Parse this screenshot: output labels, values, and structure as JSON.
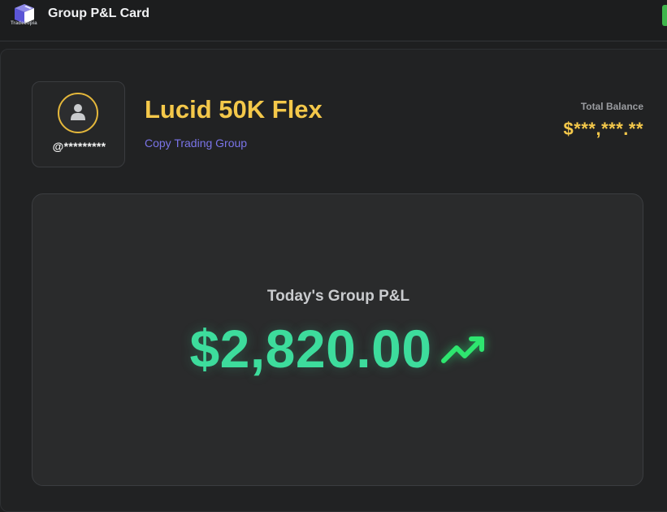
{
  "header": {
    "logo_caption": "Tradecopia",
    "title": "Group P&L Card"
  },
  "profile": {
    "avatar_icon": "user-icon",
    "username": "@*********"
  },
  "group": {
    "name": "Lucid 50K Flex",
    "type": "Copy Trading Group"
  },
  "balance": {
    "label": "Total Balance",
    "value": "$***,***.**"
  },
  "pnl": {
    "label": "Today's Group P&L",
    "value": "$2,820.00",
    "trend_icon": "trending-up-icon",
    "trend_color": "#2ee66f"
  },
  "colors": {
    "accent_gold": "#f4c84a",
    "accent_purple": "#7a74e8",
    "positive_green": "#3ddc9c",
    "background": "#1e1f20"
  }
}
